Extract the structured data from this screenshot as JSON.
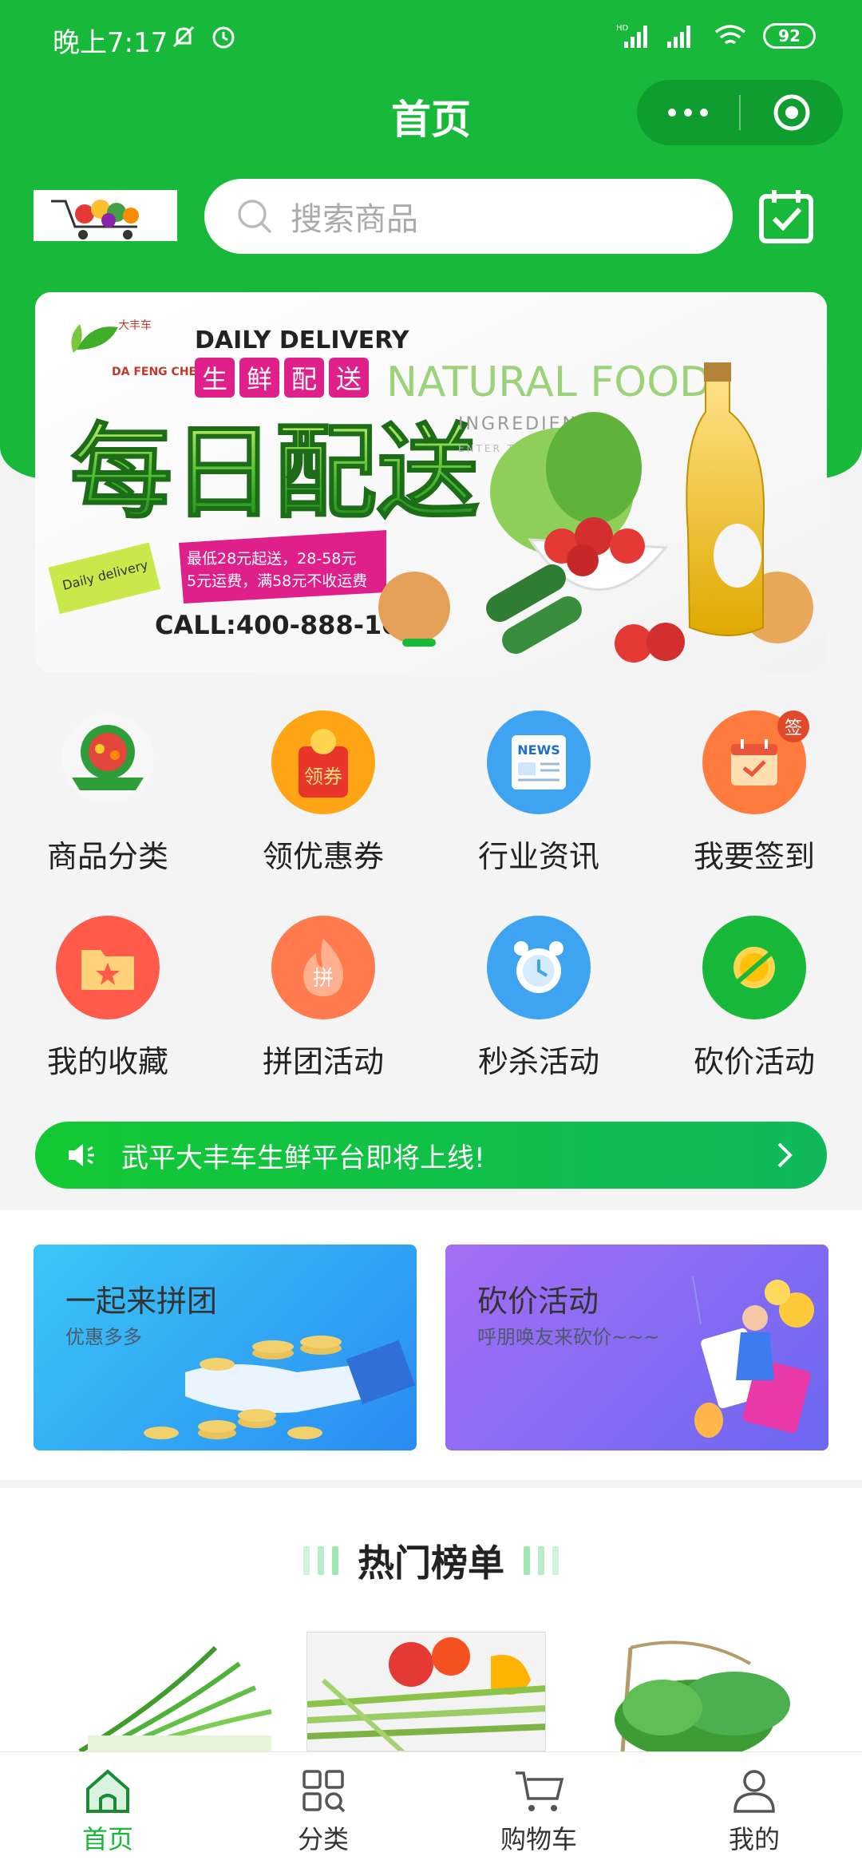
{
  "status_bar": {
    "time": "晚上7:17",
    "network": "HD",
    "battery": "92"
  },
  "header": {
    "title": "首页"
  },
  "search": {
    "placeholder": "搜索商品"
  },
  "banner": {
    "brand_cn": "大丰车",
    "brand_en": "DA FENG CHE",
    "heading_en": "DAILY DELIVERY",
    "tag_chars": [
      "生",
      "鲜",
      "配",
      "送"
    ],
    "big_title": "每日配送",
    "natural_food": "NATURAL FOOD",
    "ingredients": "INGREDIENTS",
    "enter_text": "ENTER TEXT HERE",
    "daily_stamp": "Daily delivery",
    "fee_line1": "最低28元起送，28-58元",
    "fee_line2": "5元运费，满58元不收运费",
    "call": "CALL:400-888-1080"
  },
  "menu": [
    {
      "label": "商品分类",
      "icon": "grocery-logo-icon",
      "color": "#ffffff"
    },
    {
      "label": "领优惠券",
      "icon": "coupon-icon",
      "color": "#ffa414",
      "badge": "领券"
    },
    {
      "label": "行业资讯",
      "icon": "news-icon",
      "color": "#3ea3f0",
      "badge": "NEWS"
    },
    {
      "label": "我要签到",
      "icon": "calendar-checkin-icon",
      "color": "#ff7b3d",
      "badge": "签"
    },
    {
      "label": "我的收藏",
      "icon": "folder-star-icon",
      "color": "#ff5a4a"
    },
    {
      "label": "拼团活动",
      "icon": "flame-group-icon",
      "color": "#ff7b4d",
      "badge": "拼"
    },
    {
      "label": "秒杀活动",
      "icon": "alarm-clock-icon",
      "color": "#3ea3f0"
    },
    {
      "label": "砍价活动",
      "icon": "cut-coin-icon",
      "color": "#18b93a"
    }
  ],
  "notice": {
    "text": "武平大丰车生鲜平台即将上线!"
  },
  "promo": {
    "group": {
      "title": "一起来拼团",
      "subtitle": "优惠多多"
    },
    "bargain": {
      "title": "砍价活动",
      "subtitle": "呼朋唤友来砍价~~~"
    }
  },
  "hot": {
    "title": "热门榜单"
  },
  "tabs": [
    {
      "label": "首页",
      "icon": "home-icon",
      "active": true
    },
    {
      "label": "分类",
      "icon": "category-grid-icon",
      "active": false
    },
    {
      "label": "购物车",
      "icon": "cart-icon",
      "active": false
    },
    {
      "label": "我的",
      "icon": "user-icon",
      "active": false
    }
  ],
  "colors": {
    "brand": "#18b93a",
    "brand_dark": "#0f9d2f"
  }
}
